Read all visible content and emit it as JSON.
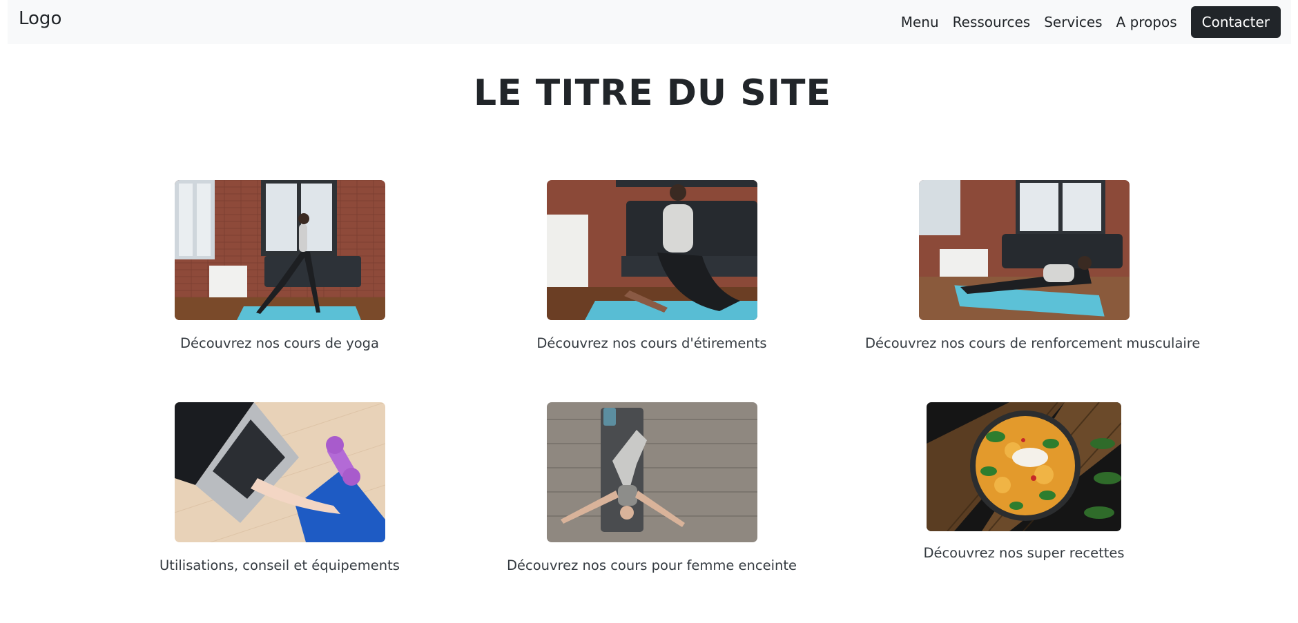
{
  "navbar": {
    "logo": "Logo",
    "links": [
      "Menu",
      "Ressources",
      "Services",
      "A propos"
    ],
    "cta_label": "Contacter"
  },
  "hero": {
    "title": "LE TITRE DU SITE"
  },
  "cards": [
    {
      "caption": "Découvrez nos cours de yoga",
      "image": "yoga-pose-photo"
    },
    {
      "caption": "Découvrez nos cours d'étirements",
      "image": "stretching-photo"
    },
    {
      "caption": "Découvrez nos cours de renforcement musculaire",
      "image": "plank-exercise-photo"
    },
    {
      "caption": "Utilisations, conseil et équipements",
      "image": "laptop-dumbbell-photo"
    },
    {
      "caption": "Découvrez nos cours pour femme enceinte",
      "image": "floor-yoga-mat-photo"
    },
    {
      "caption": "Découvrez nos super recettes",
      "image": "curry-bowl-photo"
    }
  ],
  "colors": {
    "navbar_bg": "#f8f9fa",
    "dark": "#212529",
    "brick": "#8e4a3a",
    "mat_blue": "#4fb7cf"
  }
}
